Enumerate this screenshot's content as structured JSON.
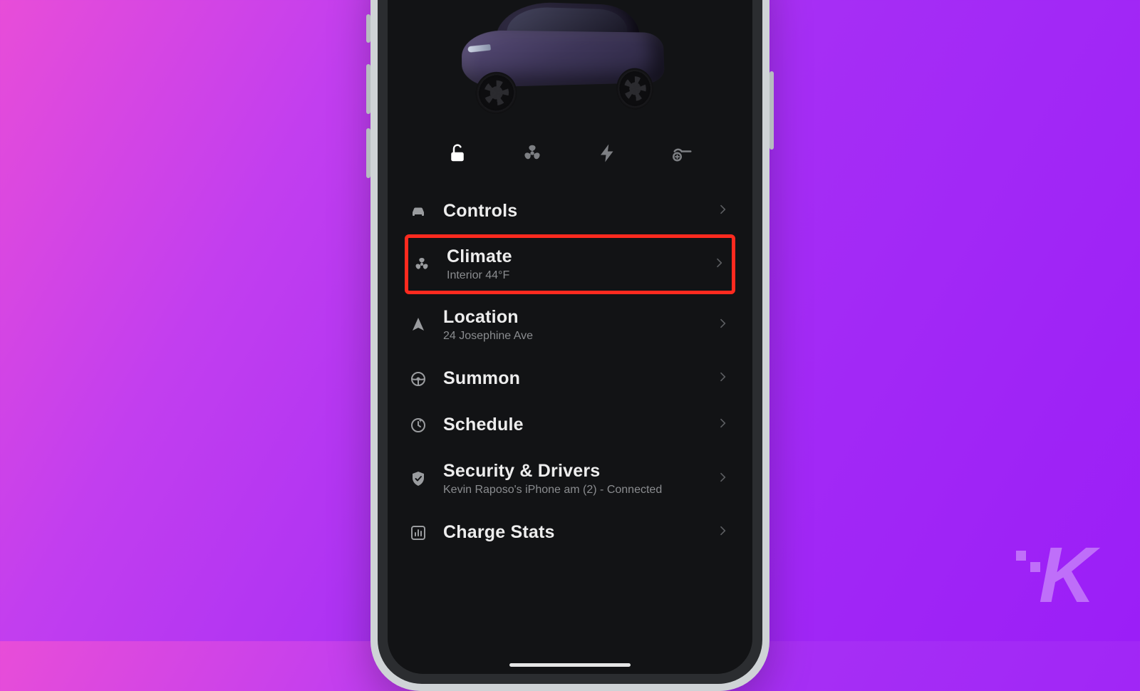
{
  "vehicle_image": {
    "color": "purple",
    "model": "sedan-crossover"
  },
  "quick_actions": [
    {
      "id": "lock",
      "icon": "unlock-icon",
      "active": true
    },
    {
      "id": "fan",
      "icon": "fan-icon",
      "active": false
    },
    {
      "id": "charge",
      "icon": "lightning-icon",
      "active": false
    },
    {
      "id": "port",
      "icon": "charge-port-icon",
      "active": false
    }
  ],
  "menu": [
    {
      "id": "controls",
      "icon": "car-front-icon",
      "title": "Controls",
      "subtitle": null,
      "highlighted": false
    },
    {
      "id": "climate",
      "icon": "fan-icon",
      "title": "Climate",
      "subtitle": "Interior 44°F",
      "highlighted": true
    },
    {
      "id": "location",
      "icon": "nav-arrow-icon",
      "title": "Location",
      "subtitle": "24 Josephine Ave",
      "highlighted": false
    },
    {
      "id": "summon",
      "icon": "steering-wheel-icon",
      "title": "Summon",
      "subtitle": null,
      "highlighted": false
    },
    {
      "id": "schedule",
      "icon": "clock-bolt-icon",
      "title": "Schedule",
      "subtitle": null,
      "highlighted": false
    },
    {
      "id": "security",
      "icon": "shield-check-icon",
      "title": "Security & Drivers",
      "subtitle": "Kevin Raposo's iPhone am (2) - Connected",
      "highlighted": false
    },
    {
      "id": "charge_stats",
      "icon": "bar-chart-icon",
      "title": "Charge Stats",
      "subtitle": null,
      "highlighted": false
    }
  ],
  "watermark": "K"
}
